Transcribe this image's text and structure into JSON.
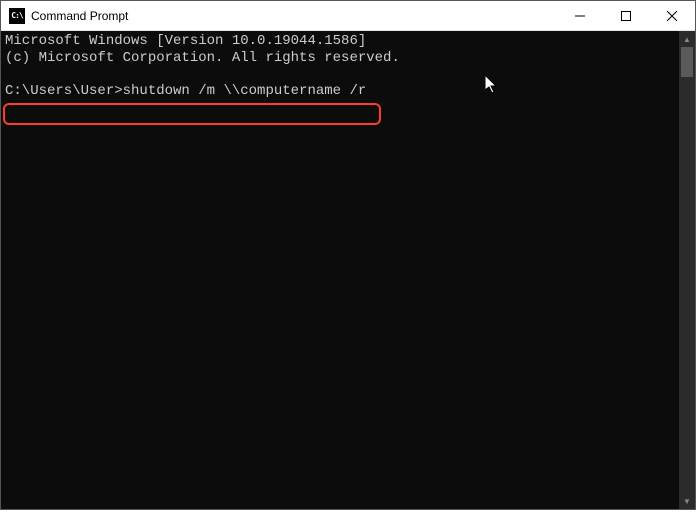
{
  "window": {
    "title": "Command Prompt",
    "icon_label": "cmd-icon"
  },
  "terminal": {
    "line1": "Microsoft Windows [Version 10.0.19044.1586]",
    "line2": "(c) Microsoft Corporation. All rights reserved.",
    "blank": "",
    "prompt": "C:\\Users\\User>",
    "command": "shutdown /m \\\\computername /r"
  },
  "controls": {
    "minimize": "Minimize",
    "maximize": "Maximize",
    "close": "Close"
  }
}
